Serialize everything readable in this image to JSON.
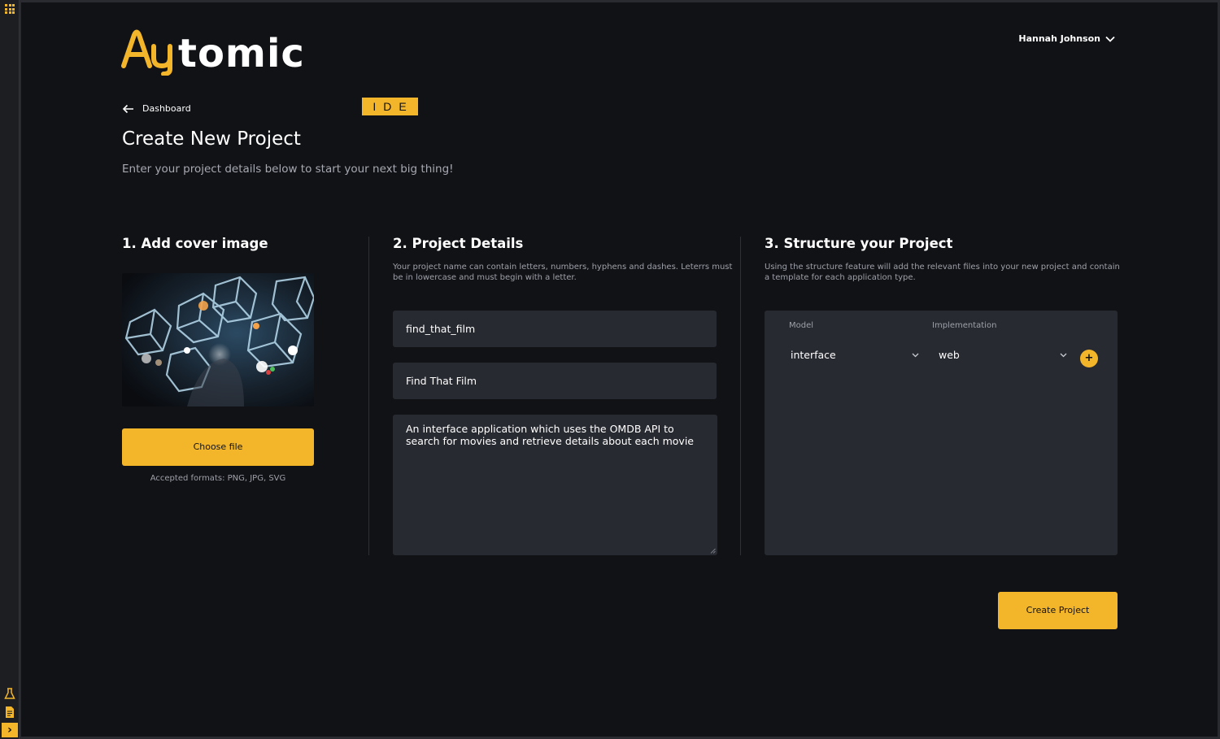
{
  "brand": {
    "logo_text": "Aytomic",
    "logo_sub": "IDE",
    "accent": "#f3b52a",
    "background": "#111216",
    "field_bg": "#282a31"
  },
  "header": {
    "user_name": "Hannah Johnson",
    "user_menu_icon": "chevron-down-icon"
  },
  "nav": {
    "back_label": "Dashboard",
    "back_icon": "arrow-left-icon"
  },
  "page": {
    "title": "Create New Project",
    "subtitle": "Enter your project details below to start your next big thing!"
  },
  "cover_section": {
    "title": "1. Add cover image",
    "choose_label": "Choose file",
    "formats": "Accepted formats: PNG, JPG, SVG"
  },
  "details_section": {
    "title": "2. Project Details",
    "description": "Your project name can contain letters, numbers, hyphens and dashes. Leterrs must be in lowercase and must begin with a letter.",
    "name_value": "find_that_film",
    "display_name_value": "Find That Film",
    "description_value": "An interface application which uses the OMDB API to search for movies and retrieve details about each movie"
  },
  "structure_section": {
    "title": "3. Structure your Project",
    "description": "Using the structure feature will add the relevant files into your new project and contain a template for each application type.",
    "model_header": "Model",
    "implementation_header": "Implementation",
    "model_value": "interface",
    "implementation_value": "web",
    "add_label": "+"
  },
  "actions": {
    "create_label": "Create Project"
  },
  "side_rail": {
    "icons": [
      "apps-grid-icon",
      "flask-icon",
      "document-icon",
      "terminal-icon"
    ],
    "active_glyph": "›"
  }
}
